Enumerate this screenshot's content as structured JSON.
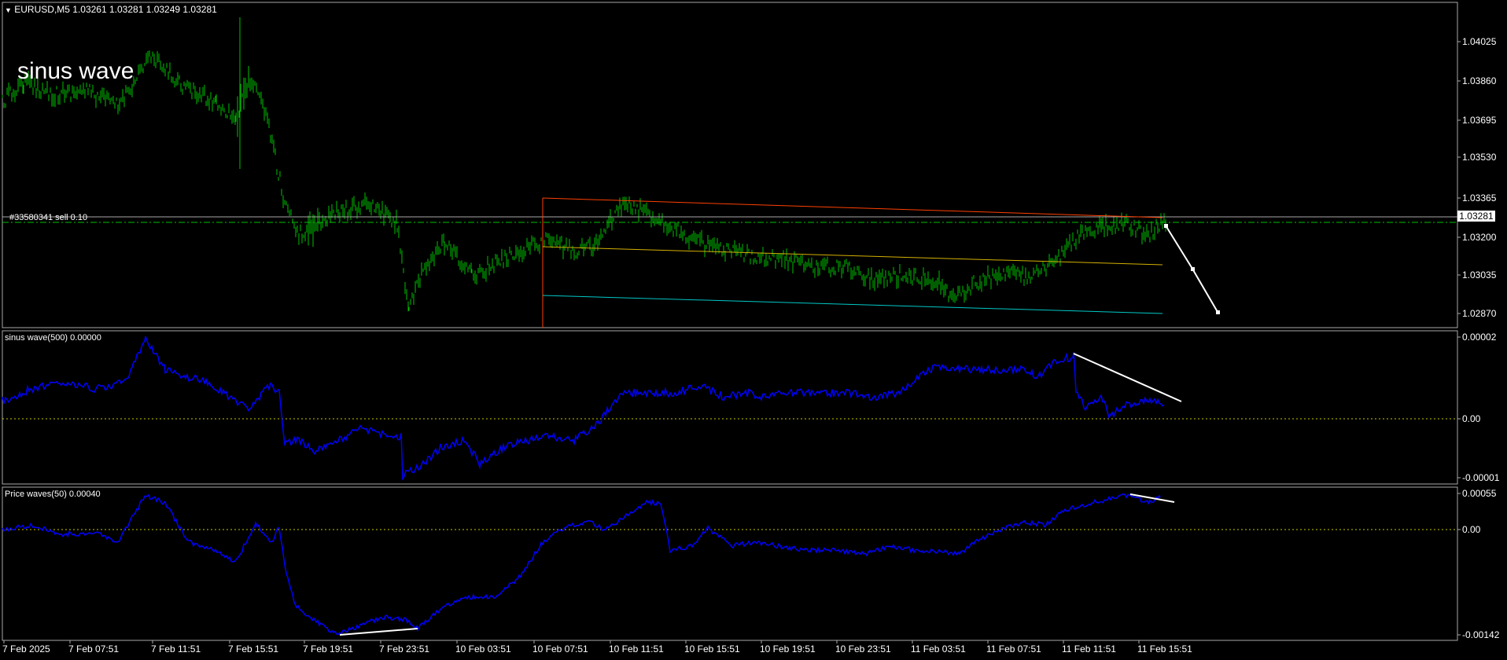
{
  "window": {
    "header": "EURUSD,M5  1.03261 1.03281 1.03249 1.03281",
    "chart_label": "sinus wave",
    "order_line_label": "#33580341 sell 0.10",
    "current_price": "1.03281"
  },
  "panes": {
    "price": {
      "ticks": [
        "1.04025",
        "1.03860",
        "1.03695",
        "1.03530",
        "1.03365",
        "1.03200",
        "1.03035",
        "1.02870"
      ]
    },
    "sinus": {
      "title": "sinus wave(500) 0.00000",
      "ticks": [
        "0.00002",
        "0.00",
        "-0.00001"
      ]
    },
    "price_waves": {
      "title": "Price waves(50) 0.00040",
      "ticks": [
        "0.00055",
        "0.00",
        "-0.00142"
      ]
    }
  },
  "time_axis": [
    "7 Feb 2025",
    "7 Feb 07:51",
    "7 Feb 11:51",
    "7 Feb 15:51",
    "7 Feb 19:51",
    "7 Feb 23:51",
    "10 Feb 03:51",
    "10 Feb 07:51",
    "10 Feb 11:51",
    "10 Feb 15:51",
    "10 Feb 19:51",
    "10 Feb 23:51",
    "11 Feb 03:51",
    "11 Feb 07:51",
    "11 Feb 11:51",
    "11 Feb 15:51"
  ],
  "colors": {
    "background": "#000000",
    "candles": "#00c000",
    "sinus_line": "#0000ff",
    "price_waves_line": "#0000ff",
    "zero_line": "#c8c800",
    "order_line": "#00c000",
    "channel_top": "#ff4000",
    "channel_mid": "#d4b000",
    "channel_bottom": "#00c8c8",
    "trend_annotations": "#ffffff"
  },
  "chart_data": [
    {
      "type": "line",
      "name": "EURUSD,M5",
      "x": [
        "7 Feb 2025",
        "7 Feb 07:51",
        "7 Feb 11:51",
        "7 Feb 15:51",
        "7 Feb 19:51",
        "7 Feb 23:51",
        "10 Feb 03:51",
        "10 Feb 07:51",
        "10 Feb 11:51",
        "10 Feb 15:51",
        "10 Feb 19:51",
        "10 Feb 23:51",
        "11 Feb 03:51",
        "11 Feb 07:51",
        "11 Feb 11:51",
        "11 Feb 15:51"
      ],
      "values": [
        1.0384,
        1.0382,
        1.0398,
        1.0372,
        1.0322,
        1.033,
        1.0305,
        1.0317,
        1.033,
        1.0318,
        1.0311,
        1.0306,
        1.0302,
        1.0308,
        1.0322,
        1.0328
      ],
      "ylim": [
        1.0282,
        1.0414
      ],
      "open": 1.03261,
      "high": 1.03281,
      "low": 1.03249,
      "close": 1.03281,
      "order_price": 1.03281
    },
    {
      "type": "line",
      "name": "sinus wave(500)",
      "x": [
        "7 Feb 2025",
        "7 Feb 07:51",
        "7 Feb 11:51",
        "7 Feb 15:51",
        "7 Feb 19:51",
        "7 Feb 23:51",
        "10 Feb 03:51",
        "10 Feb 07:51",
        "10 Feb 11:51",
        "10 Feb 15:51",
        "10 Feb 19:51",
        "10 Feb 23:51",
        "11 Feb 03:51",
        "11 Feb 07:51",
        "11 Feb 11:51",
        "11 Feb 15:51"
      ],
      "values": [
        9e-07,
        1.2e-06,
        1.8e-06,
        9e-07,
        -5e-07,
        -8e-07,
        -7e-07,
        -3e-07,
        9e-07,
        1e-06,
        8e-07,
        7e-07,
        9e-07,
        1.6e-06,
        1e-06,
        5e-07
      ],
      "ylim": [
        -1.3e-06,
        2.4e-06
      ]
    },
    {
      "type": "line",
      "name": "Price waves(50)",
      "x": [
        "7 Feb 2025",
        "7 Feb 07:51",
        "7 Feb 11:51",
        "7 Feb 15:51",
        "7 Feb 19:51",
        "7 Feb 23:51",
        "10 Feb 03:51",
        "10 Feb 07:51",
        "10 Feb 11:51",
        "10 Feb 15:51",
        "10 Feb 19:51",
        "10 Feb 23:51",
        "11 Feb 03:51",
        "11 Feb 07:51",
        "11 Feb 11:51",
        "11 Feb 15:51"
      ],
      "values": [
        2e-05,
        -3e-05,
        0.00055,
        1e-05,
        -0.00138,
        -0.0011,
        -0.00025,
        0.0002,
        0.00045,
        -0.0001,
        -0.0002,
        -0.00015,
        -0.00025,
        0.00015,
        0.00045,
        0.00048
      ],
      "ylim": [
        -0.0015,
        0.0007
      ]
    }
  ]
}
